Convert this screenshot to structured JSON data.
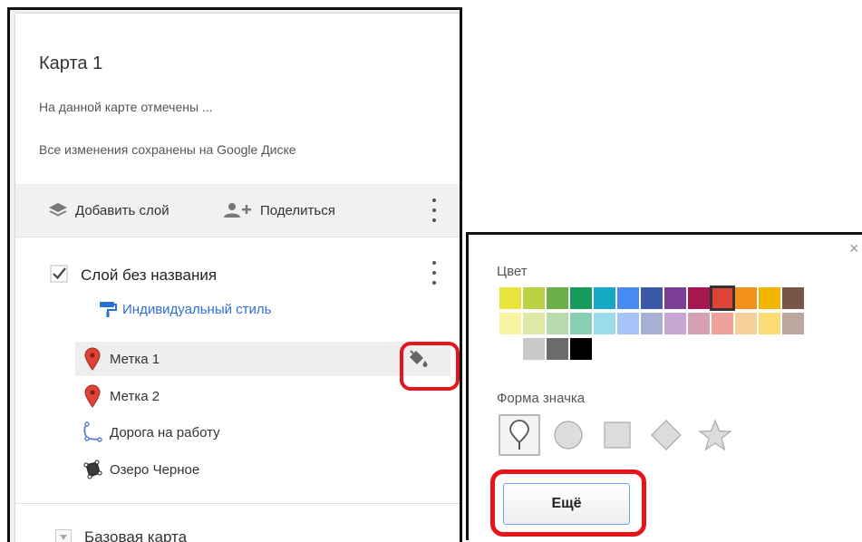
{
  "panel": {
    "title": "Карта 1",
    "description": "На данной карте отмечены ...",
    "save_status": "Все изменения сохранены на Google Диске",
    "toolbar": {
      "add_layer": "Добавить слой",
      "share": "Поделиться"
    },
    "layer": {
      "name": "Слой без названия",
      "checked": true,
      "style_link": "Индивидуальный стиль",
      "features": [
        {
          "label": "Метка 1",
          "icon": "red-pin-icon"
        },
        {
          "label": "Метка 2",
          "icon": "red-pin-icon"
        },
        {
          "label": "Дорога на работу",
          "icon": "line-path-icon"
        },
        {
          "label": "Озеро Черное",
          "icon": "polygon-icon"
        }
      ]
    },
    "base_map": "Базовая карта"
  },
  "style_popup": {
    "close": "×",
    "color_label": "Цвет",
    "colors_row1": [
      "#e8e43b",
      "#b9d144",
      "#6bb14a",
      "#159c5a",
      "#16a9c7",
      "#4a8af4",
      "#3b59a8",
      "#7b3f99",
      "#a8164f",
      "#db4437",
      "#f2911b",
      "#f4b400",
      "#795548"
    ],
    "colors_row2": [
      "#f7f3a0",
      "#dfe9a6",
      "#b7dbad",
      "#87ceb2",
      "#9bdceb",
      "#a6c4f7",
      "#a6b0d2",
      "#c6a6d3",
      "#d6a1b5",
      "#eda29a",
      "#f7cf98",
      "#fbdc74",
      "#bca79d"
    ],
    "colors_row3": [
      "#ffffff",
      "#c8c8c8",
      "#6b6b6b",
      "#000000"
    ],
    "selected_color": "#db4437",
    "shape_label": "Форма значка",
    "shapes": [
      "pin-shape-icon",
      "circle-shape-icon",
      "square-shape-icon",
      "diamond-shape-icon",
      "star-shape-icon"
    ],
    "selected_shape": "pin-shape-icon",
    "more_button": "Ещё"
  },
  "annotation_color": "#e8141b",
  "link_color": "#2a6fd6"
}
